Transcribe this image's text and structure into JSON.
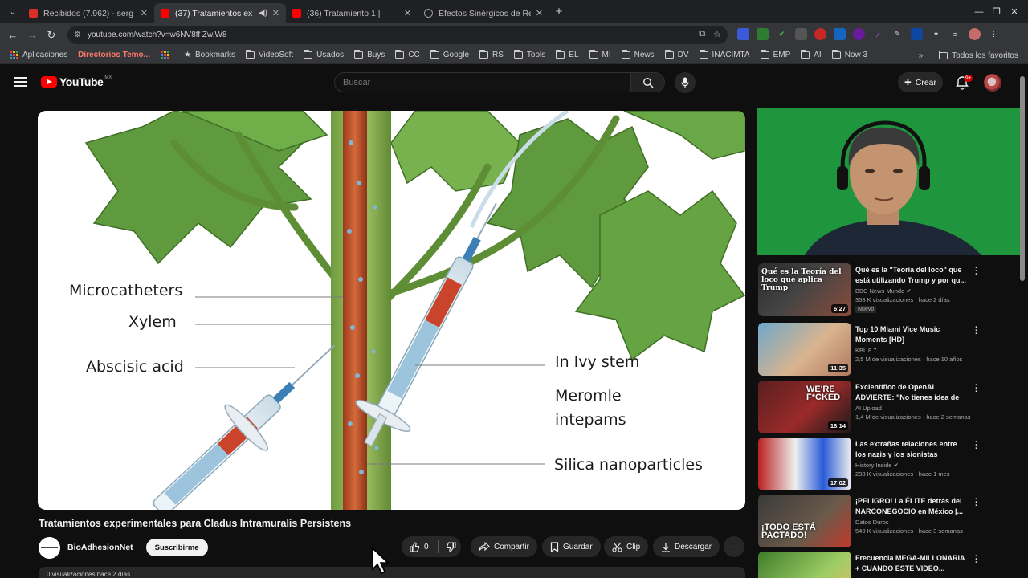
{
  "browser": {
    "tabs": [
      {
        "title": "Recibidos (7.962) - serg",
        "fav": "#d93025",
        "active": false
      },
      {
        "title": "(37) Tratamientos ex",
        "fav": "#ff0000",
        "active": true
      },
      {
        "title": "(36) Tratamiento 1 | ",
        "fav": "#ff0000",
        "active": false
      },
      {
        "title": "Efectos Sinérgicos de Re",
        "fav": "#9aa0a6",
        "active": false
      }
    ],
    "url": "youtube.com/watch?v=w6NV8ff Zw.W8",
    "bookmarks": [
      {
        "label": "Aplicaciones",
        "kind": "grid"
      },
      {
        "label": "Directorios Temo...",
        "kind": "red"
      },
      {
        "label": "",
        "kind": "grid"
      },
      {
        "label": "Bookmarks",
        "kind": "star"
      },
      {
        "label": "VideoSoft",
        "kind": "folder"
      },
      {
        "label": "Usados",
        "kind": "folder"
      },
      {
        "label": "Buys",
        "kind": "folder"
      },
      {
        "label": "CC",
        "kind": "folder"
      },
      {
        "label": "Google",
        "kind": "folder"
      },
      {
        "label": "RS",
        "kind": "folder"
      },
      {
        "label": "Tools",
        "kind": "folder"
      },
      {
        "label": "EL",
        "kind": "folder"
      },
      {
        "label": "MI",
        "kind": "folder"
      },
      {
        "label": "News",
        "kind": "folder"
      },
      {
        "label": "DV",
        "kind": "folder"
      },
      {
        "label": "INACIMTA",
        "kind": "folder"
      },
      {
        "label": "EMP",
        "kind": "folder"
      },
      {
        "label": "AI",
        "kind": "folder"
      },
      {
        "label": "Now 3",
        "kind": "folder"
      }
    ],
    "bookmarks_more": "»",
    "all_bookmarks": "Todos los favoritos"
  },
  "youtube": {
    "logo": "YouTube",
    "country": "MX",
    "search_placeholder": "Buscar",
    "create_label": "Crear",
    "notif_count": "9+",
    "video": {
      "labels": {
        "microcatheters": "Microcatheters",
        "xylem": "Xylem",
        "abscisic": "Abscisic acid",
        "ivy": "In Ivy stem",
        "meromle": "Meromle",
        "intepams": "intepams",
        "silica": "Silica nanoparticles"
      },
      "title": "Tratamientos experimentales para Cladus Intramuralis Persistens",
      "channel": "BioAdhesionNet",
      "subscribe": "Suscribirme",
      "likes": "0",
      "share": "Compartir",
      "save": "Guardar",
      "clip": "Clip",
      "download": "Descargar",
      "more": "···",
      "desc_line": "0 visualizaciones  hace 2 días"
    },
    "recommendations": [
      {
        "title": "Qué es la \"Teoría del loco\" que está utilizando Trump y por qu...",
        "channel": "BBC News Mundo ✔",
        "views": "358 K visualizaciones · hace 2 días",
        "badge": "Nuevo",
        "duration": "6:27",
        "thumb_text": "Qué es la Teoría del loco que aplica Trump"
      },
      {
        "title": "Top 10 Miami Vice Music Moments [HD]",
        "channel": "KBL 8.7",
        "views": "2,5 M de visualizaciones · hace 10 años",
        "badge": "",
        "duration": "11:35",
        "thumb_text": ""
      },
      {
        "title": "Excientífico de OpenAI ADVIERTE: \"No tienes idea de l...",
        "channel": "AI Upload",
        "views": "1,4 M de visualizaciones · hace 2 semanas",
        "badge": "",
        "duration": "18:14",
        "thumb_text": "WE'RE F*CKED"
      },
      {
        "title": "Las extrañas relaciones entre los nazis y los sionistas",
        "channel": "History Inside ✔",
        "views": "238 K visualizaciones · hace 1 mes",
        "badge": "",
        "duration": "17:02",
        "thumb_text": ""
      },
      {
        "title": "¡PELIGRO! La ÉLITE detrás del NARCONEGOCIO en México |...",
        "channel": "Datos Duros",
        "views": "540 K visualizaciones · hace 3 semanas",
        "badge": "",
        "duration": "",
        "thumb_text": "¡TODO ESTÁ PACTADO!"
      },
      {
        "title": "Frecuencia MEGA-MILLONARIA + CUANDO ESTE VIDEO...",
        "channel": "",
        "views": "",
        "badge": "",
        "duration": "",
        "thumb_text": ""
      }
    ]
  },
  "colors": {
    "yt_bg": "#0f0f0f",
    "chrome_dark": "#1f2023",
    "chrome_mid": "#35363a",
    "yt_red": "#ff0000",
    "webcam_green": "#1c8f3a"
  }
}
